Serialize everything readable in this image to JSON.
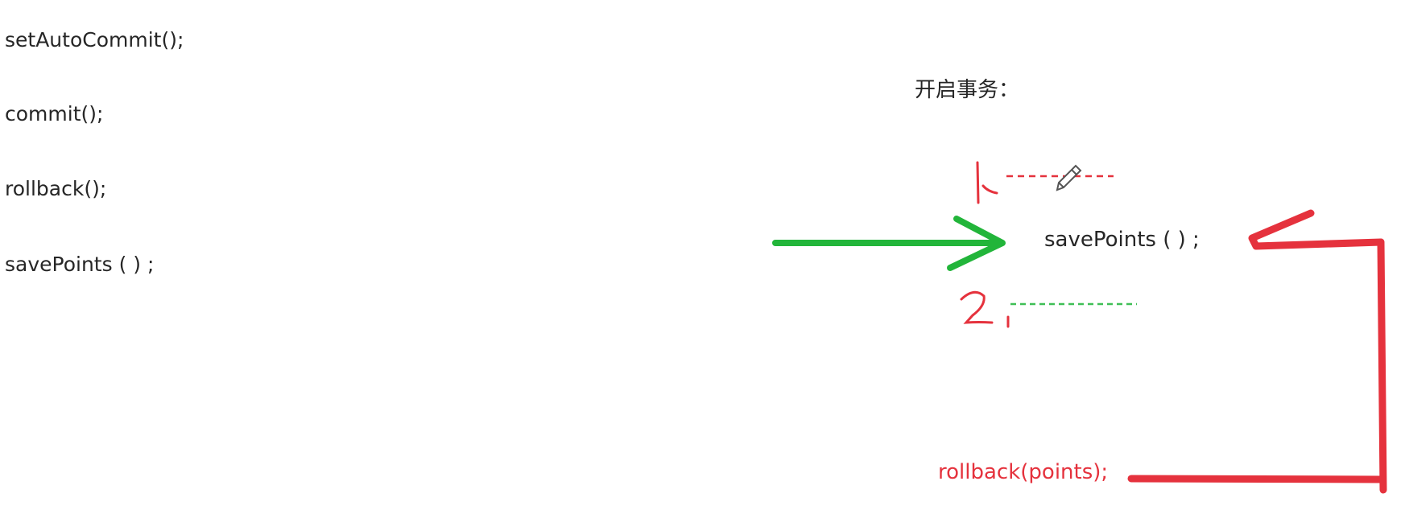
{
  "left_list": [
    {
      "text": "setAutoCommit();"
    },
    {
      "text": "commit();"
    },
    {
      "text": "rollback();"
    },
    {
      "text": "savePoints ( ) ;"
    }
  ],
  "right": {
    "heading": "开启事务：",
    "savepoint_call": "savePoints ( ) ;",
    "rollback_call": "rollback(points);",
    "step1_mark": "1、",
    "step2_mark": "2、"
  },
  "colors": {
    "text": "#262626",
    "accent_red": "#e5323d",
    "arrow_green": "#22b53a",
    "dashed_green": "#3fbf56"
  },
  "icons": [
    "pencil-icon"
  ]
}
